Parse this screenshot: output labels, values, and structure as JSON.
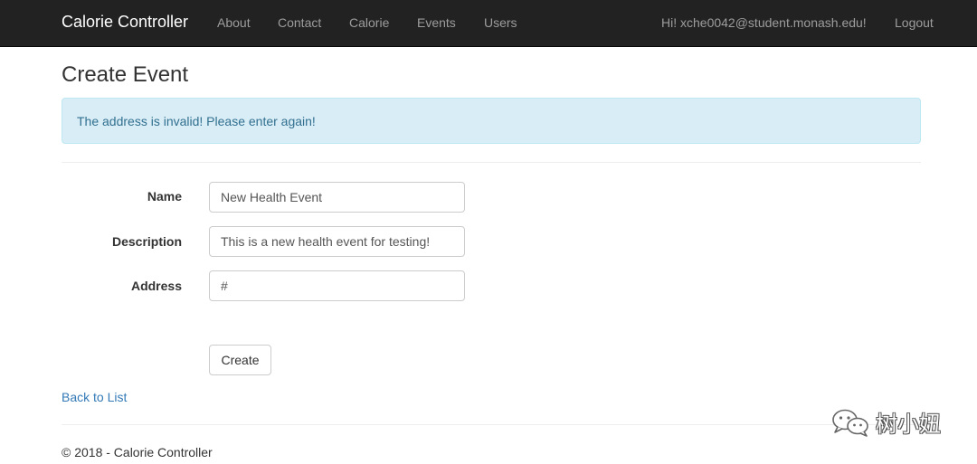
{
  "navbar": {
    "brand": "Calorie Controller",
    "links": [
      "About",
      "Contact",
      "Calorie",
      "Events",
      "Users"
    ],
    "greeting": "Hi! xche0042@student.monash.edu!",
    "logout": "Logout"
  },
  "page": {
    "title": "Create Event"
  },
  "alert": {
    "message": "The address is invalid! Please enter again!"
  },
  "form": {
    "name_label": "Name",
    "name_value": "New Health Event",
    "description_label": "Description",
    "description_value": "This is a new health event for testing!",
    "address_label": "Address",
    "address_value": "#",
    "create_button": "Create"
  },
  "back_link": "Back to List",
  "footer": "© 2018 - Calorie Controller",
  "watermark": {
    "text": "树小妞",
    "icon": "wechat-icon"
  },
  "colors": {
    "navbar_bg": "#222222",
    "alert_bg": "#d9edf7",
    "alert_text": "#31708f",
    "link": "#337ab7"
  }
}
